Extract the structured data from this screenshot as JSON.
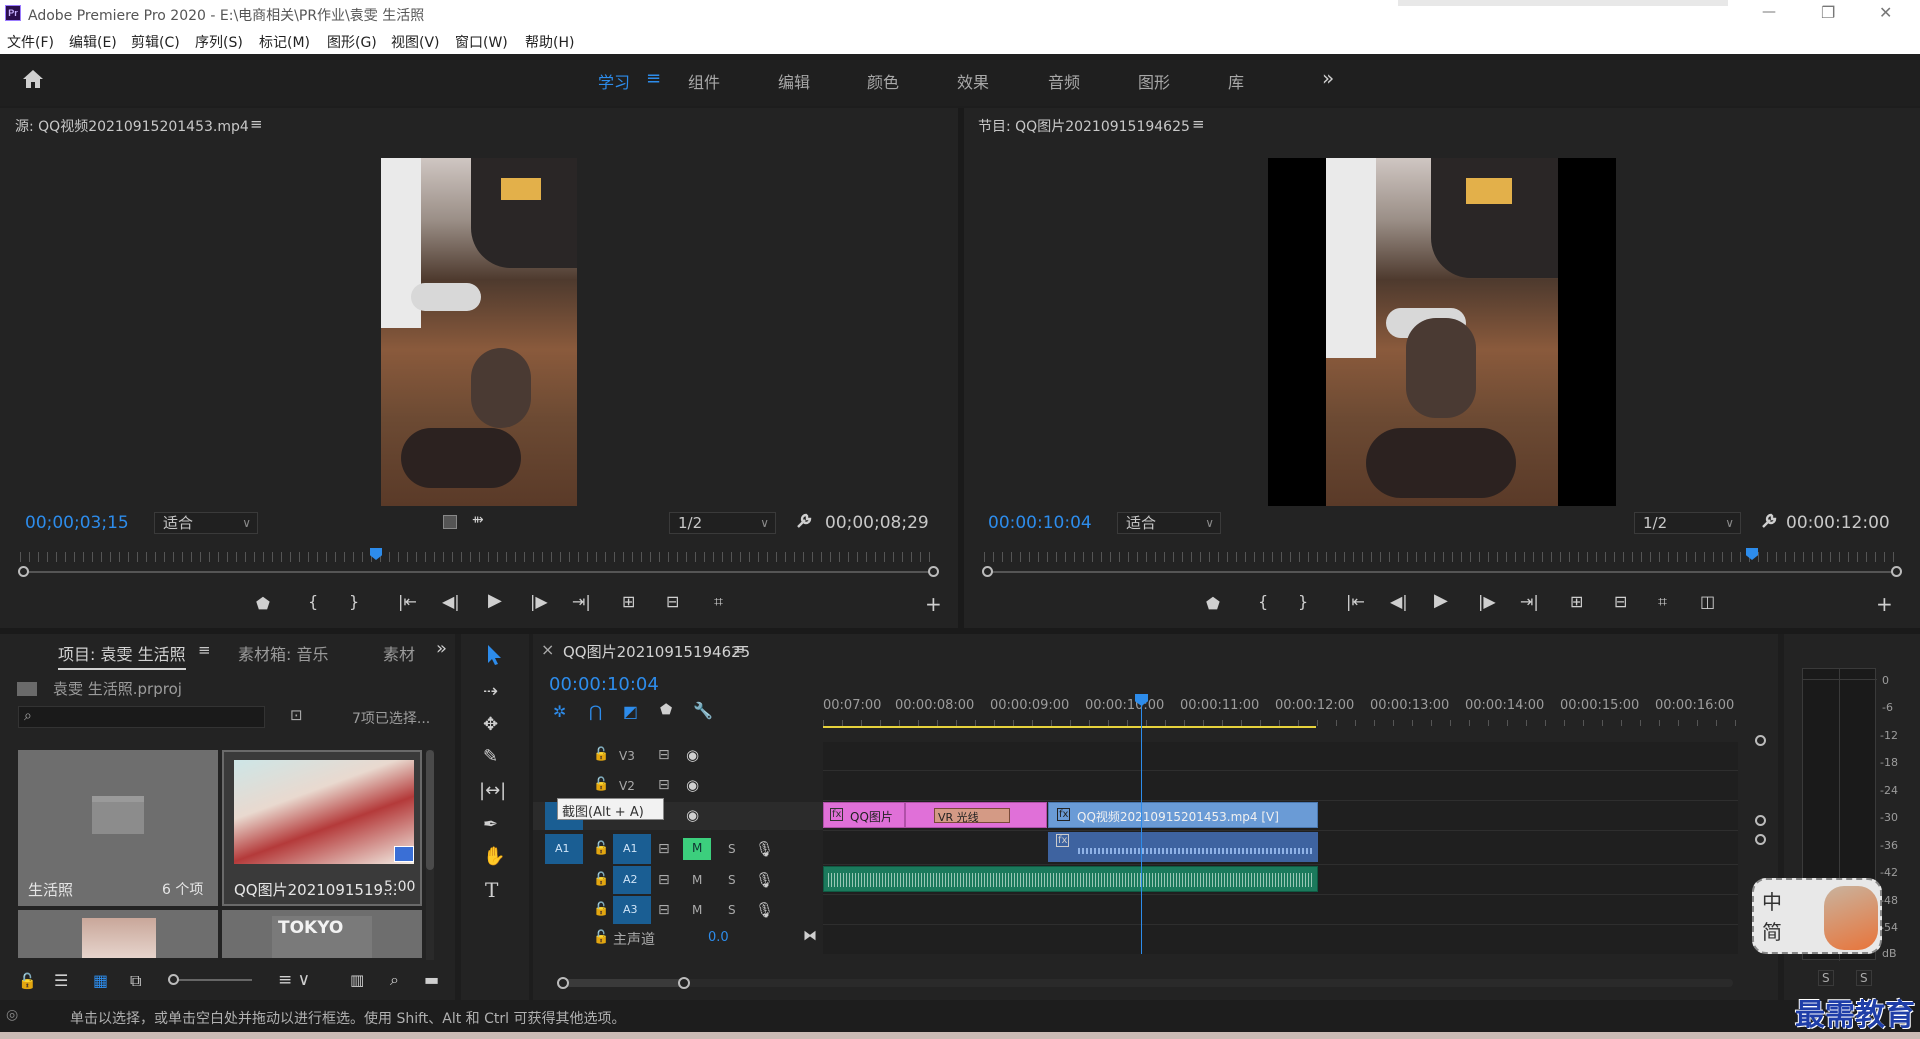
{
  "app": {
    "title": "Adobe Premiere Pro 2020 - E:\\电商相关\\PR作业\\袁雯 生活照",
    "icon_text": "Pr"
  },
  "window_controls": {
    "minimize": "—",
    "restore": "❐",
    "close": "✕"
  },
  "menu": [
    "文件(F)",
    "编辑(E)",
    "剪辑(C)",
    "序列(S)",
    "标记(M)",
    "图形(G)",
    "视图(V)",
    "窗口(W)",
    "帮助(H)"
  ],
  "workspaces": {
    "tabs": [
      "学习",
      "组件",
      "编辑",
      "颜色",
      "效果",
      "音频",
      "图形",
      "库"
    ],
    "active": "学习",
    "more": "»"
  },
  "source_monitor": {
    "title": "源: QQ视频20210915201453.mp4",
    "menu_icon": "≡",
    "timecode": "00;00;03;15",
    "fit": "适合",
    "resolution": "1/2",
    "duration": "00;00;08;29",
    "playhead_fraction": 0.39
  },
  "program_monitor": {
    "title": "节目: QQ图片20210915194625",
    "menu_icon": "≡",
    "timecode": "00:00:10:04",
    "fit": "适合",
    "resolution": "1/2",
    "duration": "00:00:12:00",
    "playhead_fraction": 0.84
  },
  "project_panel": {
    "tabs": [
      "项目: 袁雯 生活照",
      "素材箱: 音乐",
      "素材"
    ],
    "menu_icon": "≡",
    "more": "»",
    "file": "袁雯 生活照.prproj",
    "search_placeholder": "",
    "selection": "7项已选择...",
    "items": [
      {
        "name": "生活照",
        "meta": "6 个项"
      },
      {
        "name": "QQ图片2021091519...",
        "meta": "5:00"
      },
      {
        "name": "",
        "meta": ""
      },
      {
        "name": "TOKYO",
        "meta": ""
      }
    ]
  },
  "timeline": {
    "close": "×",
    "title": "QQ图片20210915194625",
    "menu_icon": "≡",
    "timecode": "00:00:10:04",
    "ruler": [
      "00:07:00",
      "00:00:08:00",
      "00:00:09:00",
      "00:00:10:00",
      "00:00:11:00",
      "00:00:12:00",
      "00:00:13:00",
      "00:00:14:00",
      "00:00:15:00",
      "00:00:16:00"
    ],
    "tracks_video": [
      "V3",
      "V2",
      "V1"
    ],
    "tracks_audio": [
      "A1",
      "A2",
      "A3"
    ],
    "src_patch_video": "V1",
    "src_patch_audio": "A1",
    "mute": "M",
    "solo": "S",
    "master": "主声道",
    "master_value": "0.0",
    "tooltip": "截图(Alt + A)",
    "clips": {
      "qq_image": "QQ图片",
      "vr": "VR 光线",
      "video": "QQ视频20210915201453.mp4 [V]"
    }
  },
  "meter": {
    "scale": [
      "0",
      "-6",
      "-12",
      "-18",
      "-24",
      "-30",
      "-36",
      "-42",
      "-48",
      "-54",
      "dB"
    ],
    "solo_left": "S",
    "solo_right": "S"
  },
  "status_bar": {
    "text": "单击以选择，或单击空白处并拖动以进行框选。使用 Shift、Alt 和 Ctrl 可获得其他选项。"
  },
  "overlay": {
    "ime_top": "中",
    "ime_bottom": "简",
    "watermark": "最需教育"
  },
  "colors": {
    "accent_blue": "#2d8ceb",
    "clip_pink": "#e070d8",
    "clip_blue": "#6a9bd6",
    "audio_green": "#1b7a5c",
    "track_btn_blue": "#1a5e93",
    "mute_active": "#3ccf7d"
  }
}
